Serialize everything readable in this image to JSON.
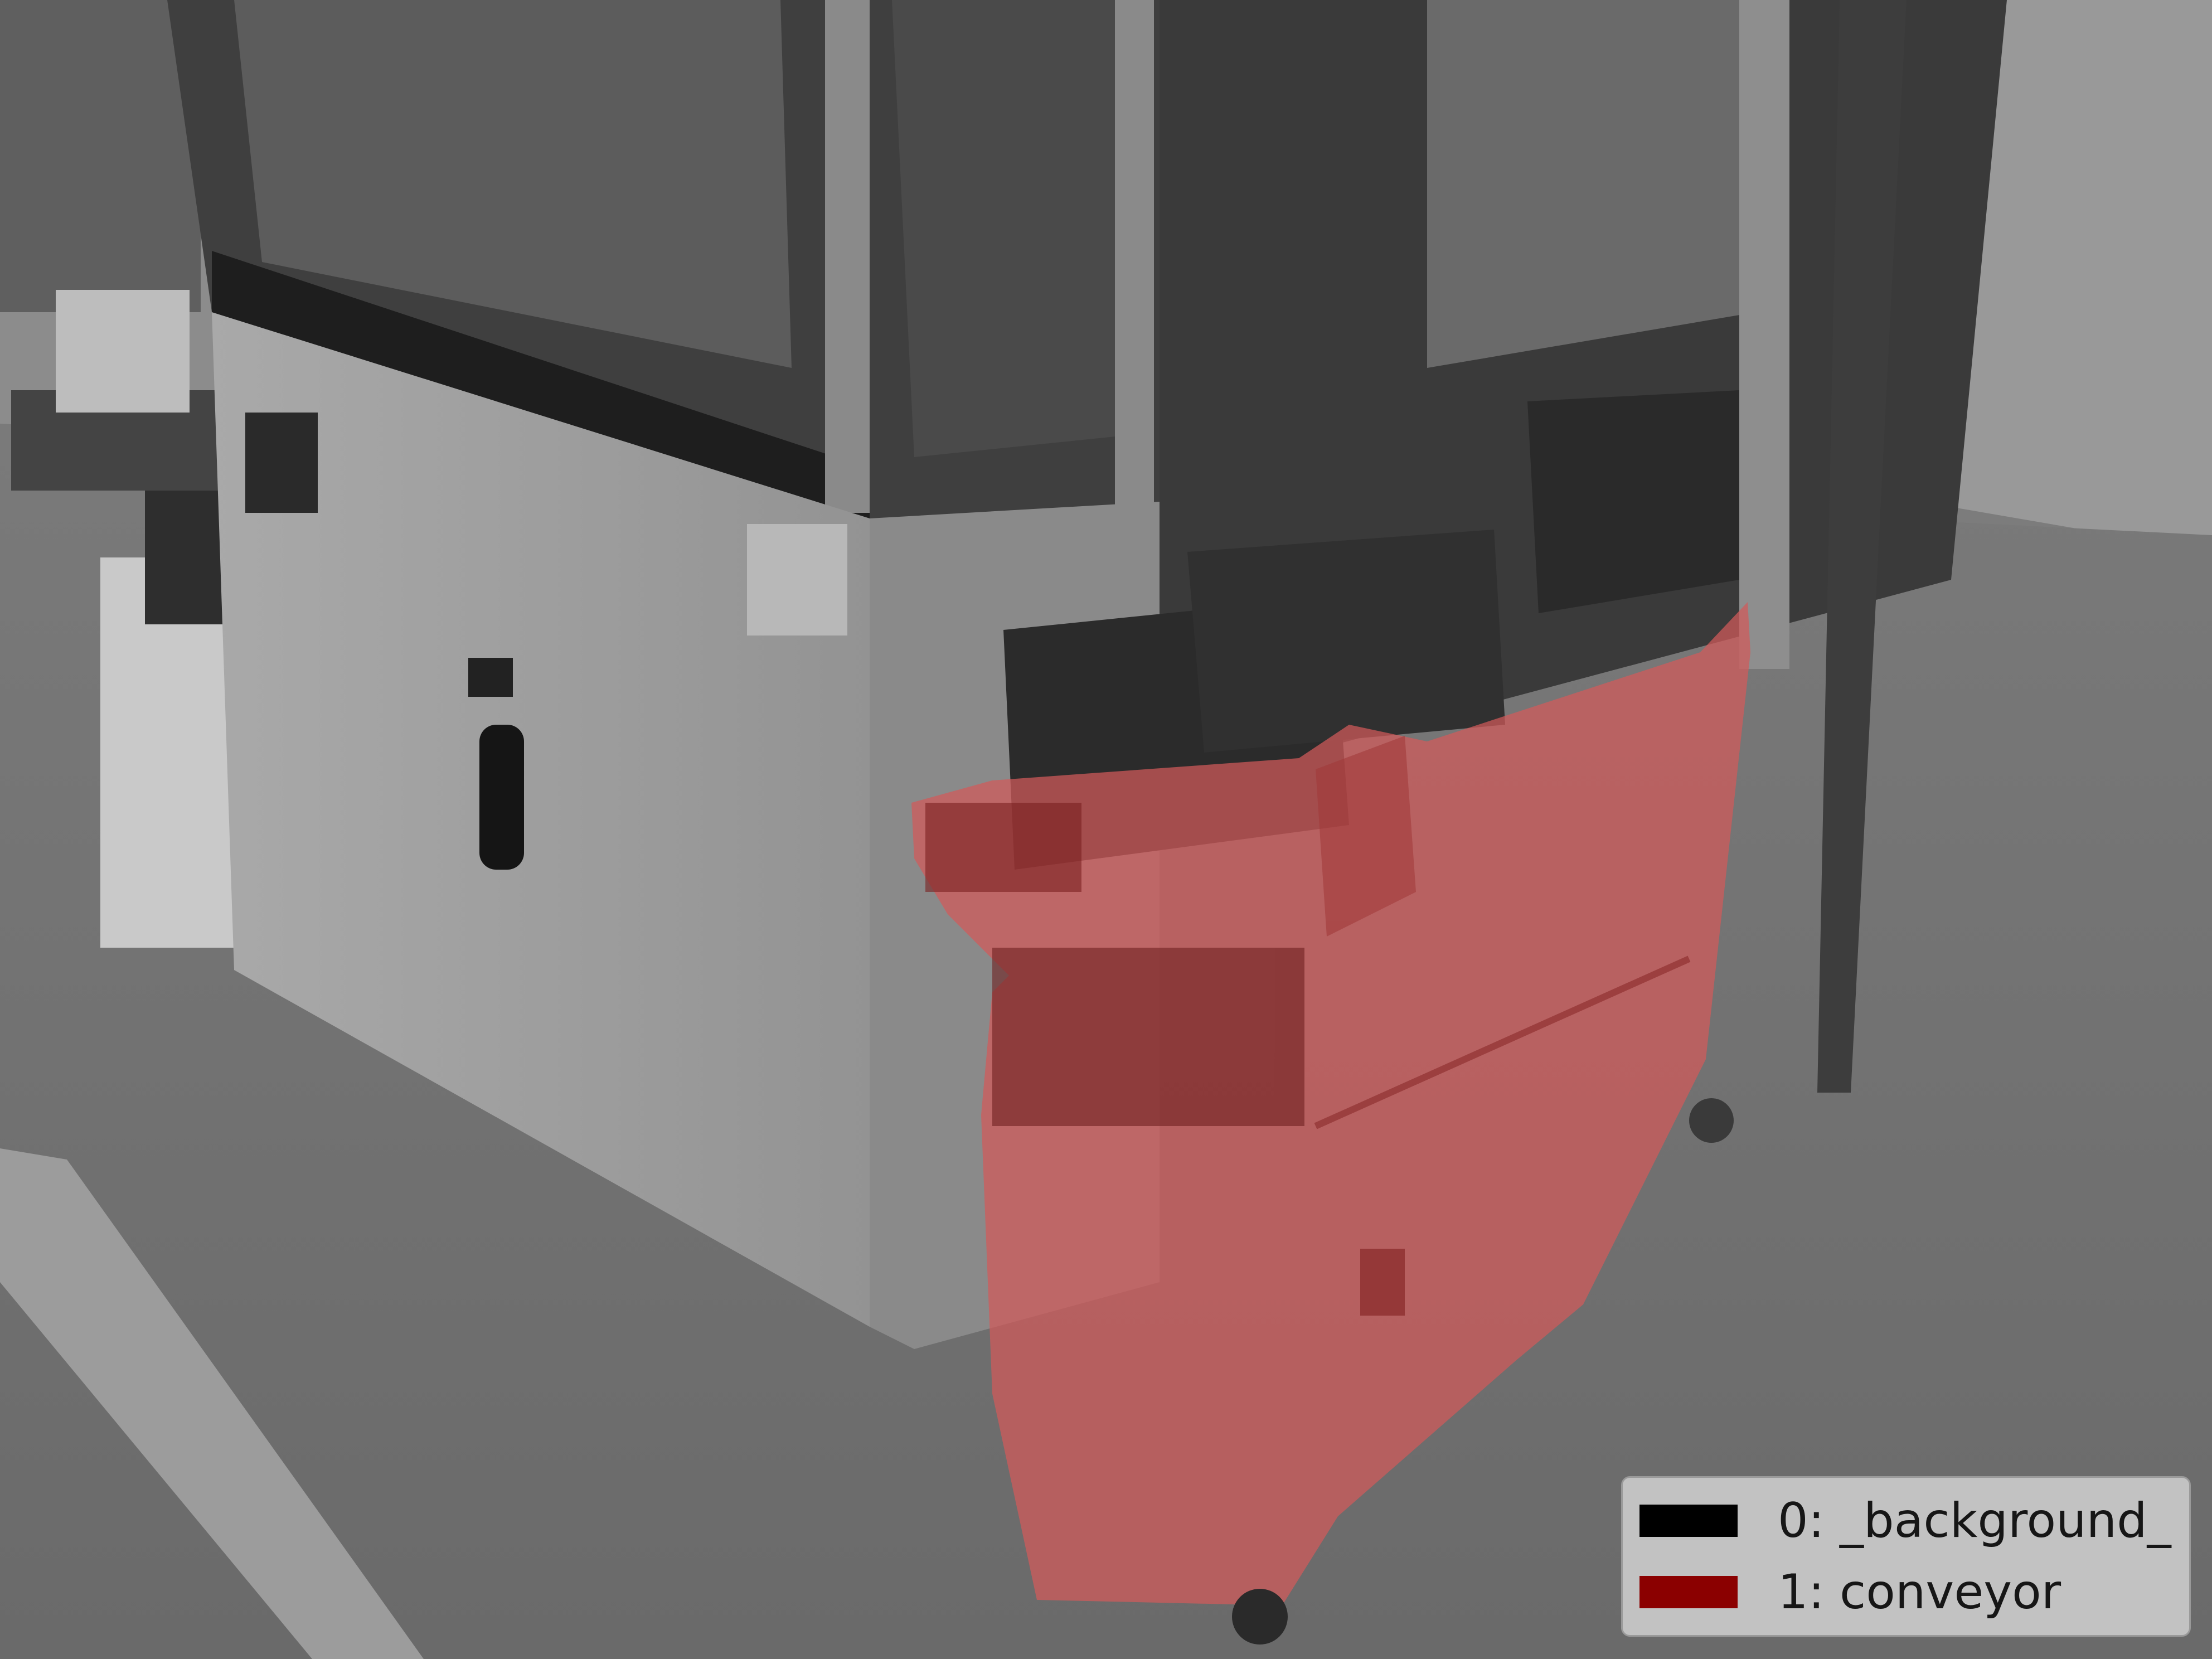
{
  "legend": {
    "items": [
      {
        "label": "0: _background_",
        "color": "#000000"
      },
      {
        "label": "1: conveyor",
        "color": "#8b0000"
      }
    ]
  },
  "overlay": {
    "highlight_color": "#d35a5a",
    "highlight_opacity": 0.72
  }
}
